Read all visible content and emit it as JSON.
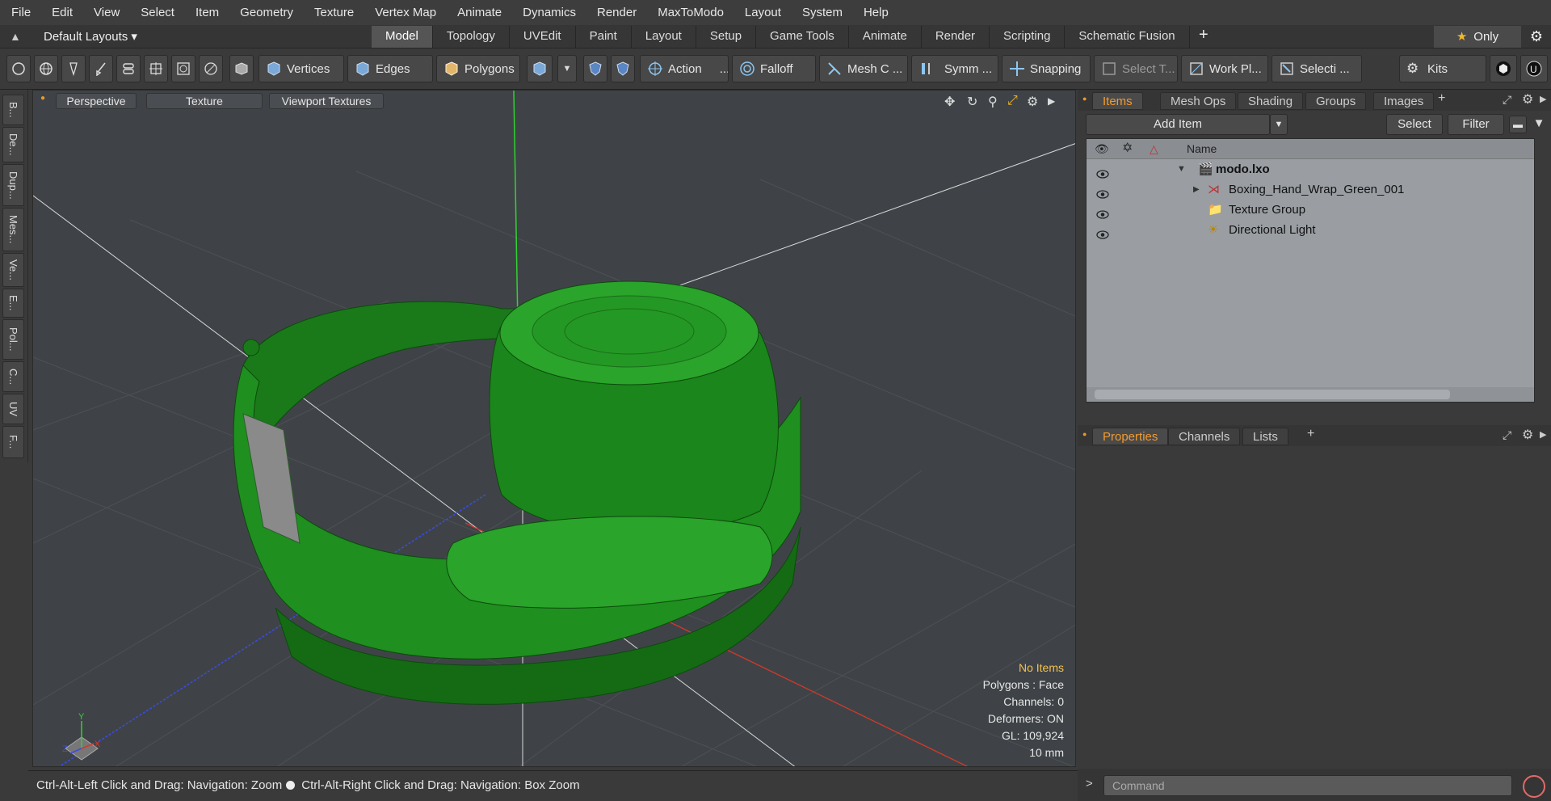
{
  "menu": [
    "File",
    "Edit",
    "View",
    "Select",
    "Item",
    "Geometry",
    "Texture",
    "Vertex Map",
    "Animate",
    "Dynamics",
    "Render",
    "MaxToModo",
    "Layout",
    "System",
    "Help"
  ],
  "layout": {
    "default_label": "Default Layouts ▾"
  },
  "tabs": [
    "Model",
    "Topology",
    "UVEdit",
    "Paint",
    "Layout",
    "Setup",
    "Game Tools",
    "Animate",
    "Render",
    "Scripting",
    "Schematic Fusion"
  ],
  "active_tab": "Model",
  "only_label": "Only",
  "toolbar": {
    "vertices": "Vertices",
    "edges": "Edges",
    "polygons": "Polygons",
    "action": "Action",
    "falloff": "Falloff",
    "mesh": "Mesh C ...",
    "symm": "Symm ...",
    "snapping": "Snapping",
    "select_t": "Select T...",
    "workpl": "Work Pl...",
    "selecti": "Selecti ...",
    "kits": "Kits"
  },
  "left_tabs": [
    "B...",
    "De...",
    "Dup...",
    "Mes...",
    "Ve...",
    "E...",
    "Pol...",
    "C...",
    "UV",
    "F..."
  ],
  "viewport": {
    "perspective": "Perspective",
    "texture": "Texture",
    "viewport_textures": "Viewport Textures",
    "info": {
      "no_items": "No Items",
      "polygons": "Polygons : Face",
      "channels": "Channels: 0",
      "deformers": "Deformers: ON",
      "gl": "GL: 109,924",
      "units": "10 mm"
    },
    "axis": {
      "x": "X",
      "y": "Y",
      "z": "Z"
    }
  },
  "status": {
    "left": "Ctrl-Alt-Left Click and Drag: Navigation: Zoom",
    "right": "Ctrl-Alt-Right Click and Drag: Navigation: Box Zoom"
  },
  "right": {
    "tabs": [
      "Items",
      "Mesh Ops",
      "Shading",
      "Groups",
      "Images"
    ],
    "add_item": "Add Item",
    "select": "Select",
    "filter": "Filter",
    "name_header": "Name",
    "items": [
      {
        "label": "modo.lxo"
      },
      {
        "label": "Boxing_Hand_Wrap_Green_001"
      },
      {
        "label": "Texture Group"
      },
      {
        "label": "Directional Light"
      }
    ],
    "prop_tabs": [
      "Properties",
      "Channels",
      "Lists"
    ],
    "command_placeholder": "Command"
  },
  "colors": {
    "accent": "#f29a2e",
    "model_green": "#1e8c1e"
  }
}
